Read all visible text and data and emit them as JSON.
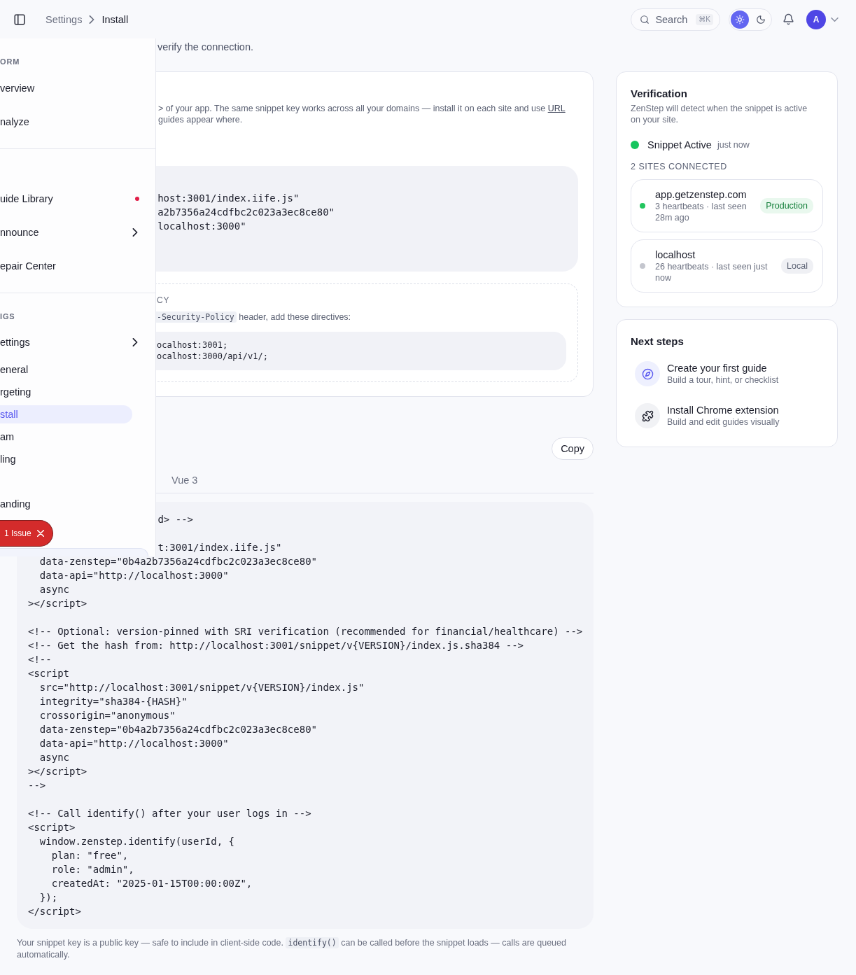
{
  "topbar": {
    "breadcrumb": [
      {
        "label": "Settings",
        "current": false
      },
      {
        "label": "Install",
        "current": true
      }
    ],
    "search": {
      "placeholder": "Search",
      "shortcut": "⌘K"
    },
    "theme_options": [
      {
        "kind": "light",
        "selected": true
      },
      {
        "kind": "dark",
        "selected": false
      }
    ],
    "avatar": {
      "initial": "A"
    }
  },
  "sidebar": {
    "sections": [
      {
        "label": "ORM",
        "items": [
          {
            "label": "verview",
            "kind": "plain",
            "selected": false
          },
          {
            "label": "nalyze",
            "kind": "plain",
            "selected": false
          }
        ]
      },
      {
        "items": [
          {
            "label": "uide Library",
            "kind": "alert",
            "selected": false
          },
          {
            "label": "nnounce",
            "kind": "submenu",
            "selected": false
          },
          {
            "label": "epair Center",
            "kind": "plain",
            "selected": false
          }
        ]
      },
      {
        "label": "IGS",
        "items": [
          {
            "label": "ettings",
            "kind": "submenu",
            "selected": false,
            "children": [
              {
                "label": "eneral",
                "selected": false
              },
              {
                "label": "rgeting",
                "selected": false
              },
              {
                "label": "stall",
                "selected": true
              },
              {
                "label": "am",
                "selected": false
              },
              {
                "label": "ling",
                "selected": false
              },
              {
                "selected": false
              },
              {
                "label": "anding",
                "selected": false
              }
            ]
          }
        ]
      }
    ],
    "issue_badge": {
      "label": "1 Issue"
    }
  },
  "intro": "verify the connection.",
  "snippet_card": {
    "description": {
      "line_1": "> of your app. The same snippet key works across all your domains — install it on each site and use",
      "link": "URL",
      "line_2": "guides appear where."
    },
    "code": "host:3001/index.iife.js\"\na2b7356a24cdfbc2c023a3ec8ce80\"\nlocalhost:3000\"",
    "csp": {
      "heading": "CY",
      "header_code": "-Security-Policy",
      "instruction": "header, add these directives:",
      "code": "ocalhost:3001;\nocalhost:3000/api/v1/;"
    }
  },
  "copy_button": "Copy",
  "tabs": [
    {
      "label": "Vue 3",
      "selected": false
    }
  ],
  "code_block": {
    "partial": "d> -->\n\nt:3001/index.iife.js\"",
    "code": "  data-zenstep=\"0b4a2b7356a24cdfbc2c023a3ec8ce80\"\n  data-api=\"http://localhost:3000\"\n  async\n></script>\n\n<!-- Optional: version-pinned with SRI verification (recommended for financial/healthcare) -->\n<!-- Get the hash from: http://localhost:3001/snippet/v{VERSION}/index.js.sha384 -->\n<!--\n<script\n  src=\"http://localhost:3001/snippet/v{VERSION}/index.js\"\n  integrity=\"sha384-{HASH}\"\n  crossorigin=\"anonymous\"\n  data-zenstep=\"0b4a2b7356a24cdfbc2c023a3ec8ce80\"\n  data-api=\"http://localhost:3000\"\n  async\n></script>\n-->\n\n<!-- Call identify() after your user logs in -->\n<script>\n  window.zenstep.identify(userId, {\n    plan: \"free\",\n    role: \"admin\",\n    createdAt: \"2025-01-15T00:00:00Z\",\n  });\n</script>"
  },
  "footer_note": {
    "before": "Your snippet key is a public key — safe to include in client-side code.",
    "code": "identify()",
    "after": "can be called before the snippet loads — calls are queued automatically."
  },
  "verification": {
    "title": "Verification",
    "description": "ZenStep will detect when the snippet is active on your site.",
    "status": {
      "label": "Snippet Active",
      "time": "just now",
      "active": true
    },
    "sites_label": "2 SITES CONNECTED",
    "sites": [
      {
        "name": "app.getzenstep.com",
        "meta": "3 heartbeats · last seen 28m ago",
        "badge": "Production",
        "kind": "production",
        "color": "#22c55e"
      },
      {
        "name": "localhost",
        "meta": "26 heartbeats · last seen just now",
        "badge": "Local",
        "kind": "local",
        "color": "#c4c6ce"
      }
    ]
  },
  "next_steps": {
    "title": "Next steps",
    "items": [
      {
        "kind": "guide",
        "title": "Create your first guide",
        "subtitle": "Build a tour, hint, or checklist"
      },
      {
        "kind": "extension",
        "title": "Install Chrome extension",
        "subtitle": "Build and edit guides visually"
      }
    ]
  }
}
